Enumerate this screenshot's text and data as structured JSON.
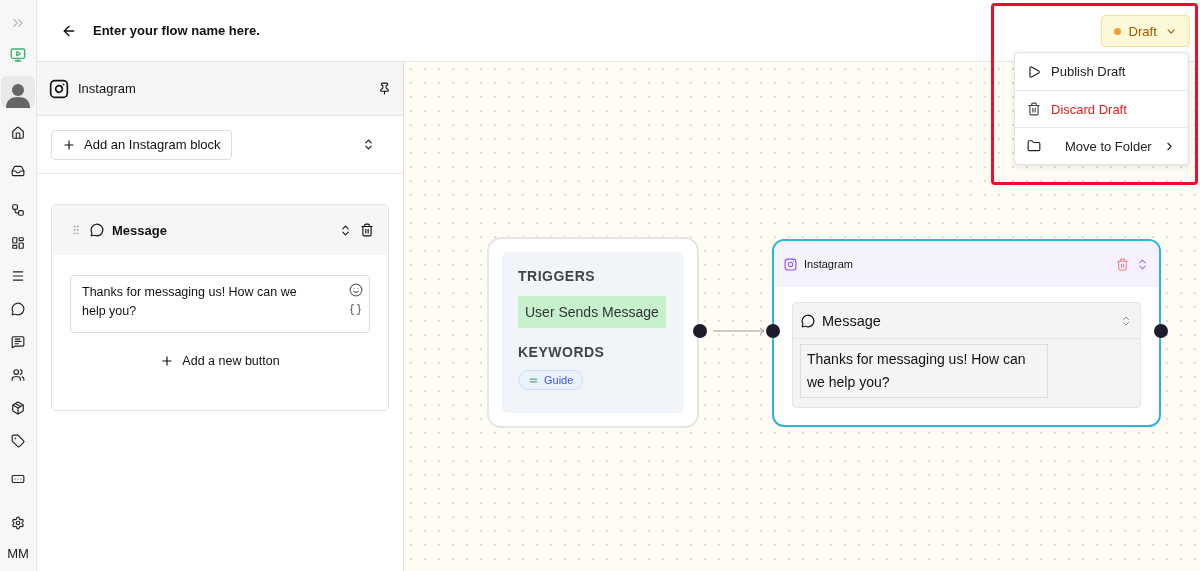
{
  "rail": {
    "initials": "MM"
  },
  "header": {
    "title": "Enter your flow name here.",
    "status": {
      "label": "Draft",
      "color": "#f0a030"
    }
  },
  "status_menu": [
    {
      "kind": "publish",
      "label": "Publish Draft"
    },
    {
      "kind": "discard",
      "label": "Discard Draft"
    },
    {
      "kind": "folder",
      "label": "Move to Folder"
    }
  ],
  "panel": {
    "title": "Instagram",
    "add_block": "Add an Instagram block",
    "block": {
      "title": "Message",
      "text": "Thanks for messaging us! How can we help you?",
      "add_button": "Add a new button"
    }
  },
  "canvas": {
    "trigger_node": {
      "triggers_heading": "TRIGGERS",
      "trigger": "User Sends Message",
      "keywords_heading": "KEYWORDS",
      "keywords": [
        "Guide"
      ]
    },
    "instagram_node": {
      "title": "Instagram",
      "block_title": "Message",
      "text": "Thanks for messaging us! How can we help you?"
    }
  }
}
